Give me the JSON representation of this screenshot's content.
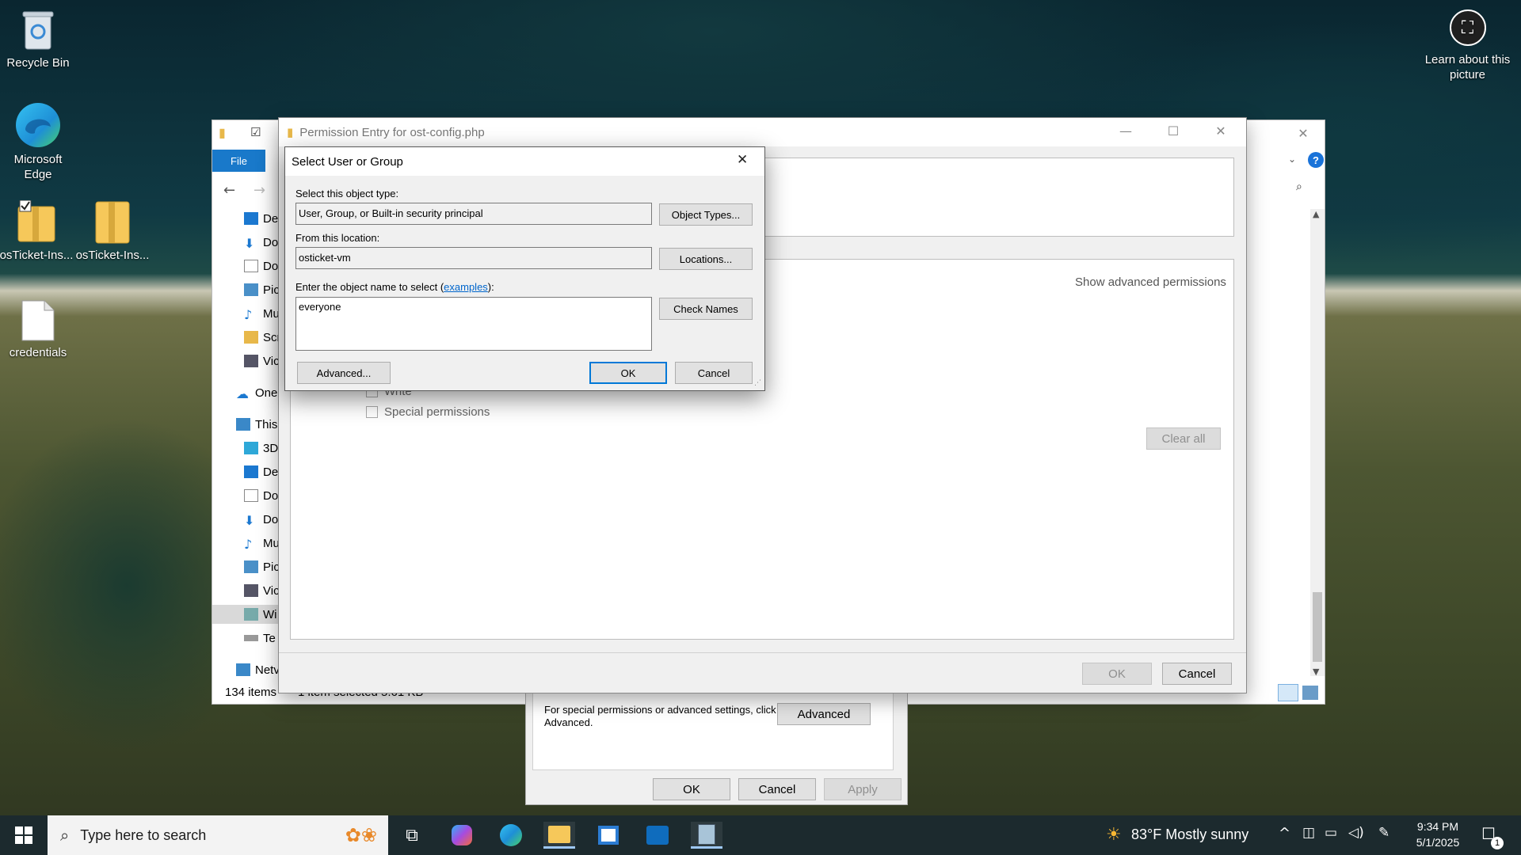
{
  "desktop": {
    "icons": [
      {
        "label": "Recycle Bin"
      },
      {
        "label": "Microsoft Edge"
      },
      {
        "label": "osTicket-Ins..."
      },
      {
        "label": "osTicket-Ins..."
      },
      {
        "label": "credentials"
      }
    ],
    "learn_label": "Learn about this picture"
  },
  "explorer": {
    "file_tab": "File",
    "tree": [
      "De",
      "Do",
      "Do",
      "Pic",
      "Mu",
      "Scr",
      "Vic",
      "One",
      "This",
      "3D",
      "De",
      "Do",
      "Do",
      "Mu",
      "Pic",
      "Vic",
      "Wi",
      "Te",
      "Netv"
    ],
    "status_items": "134 items",
    "status_selected": "1 item selected  5.61 KB"
  },
  "permission_entry": {
    "title": "Permission Entry for ost-config.php",
    "show_advanced": "Show advanced permissions",
    "checkbox_write": "Write",
    "checkbox_special": "Special permissions",
    "clear_all": "Clear all",
    "ok": "OK",
    "cancel": "Cancel"
  },
  "properties": {
    "hint": "For special permissions or advanced settings, click Advanced.",
    "advanced": "Advanced",
    "ok": "OK",
    "cancel": "Cancel",
    "apply": "Apply"
  },
  "select_dialog": {
    "title": "Select User or Group",
    "object_type_label": "Select this object type:",
    "object_type_value": "User, Group, or Built-in security principal",
    "object_types_btn": "Object Types...",
    "location_label": "From this location:",
    "location_value": "osticket-vm",
    "locations_btn": "Locations...",
    "enter_label_prefix": "Enter the object name to select (",
    "examples_link": "examples",
    "enter_label_suffix": "):",
    "object_name_value": "everyone",
    "check_names_btn": "Check Names",
    "advanced_btn": "Advanced...",
    "ok_btn": "OK",
    "cancel_btn": "Cancel"
  },
  "taskbar": {
    "search_placeholder": "Type here to search",
    "weather": "83°F  Mostly sunny",
    "time": "9:34 PM",
    "date": "5/1/2025",
    "notification_count": "1"
  }
}
